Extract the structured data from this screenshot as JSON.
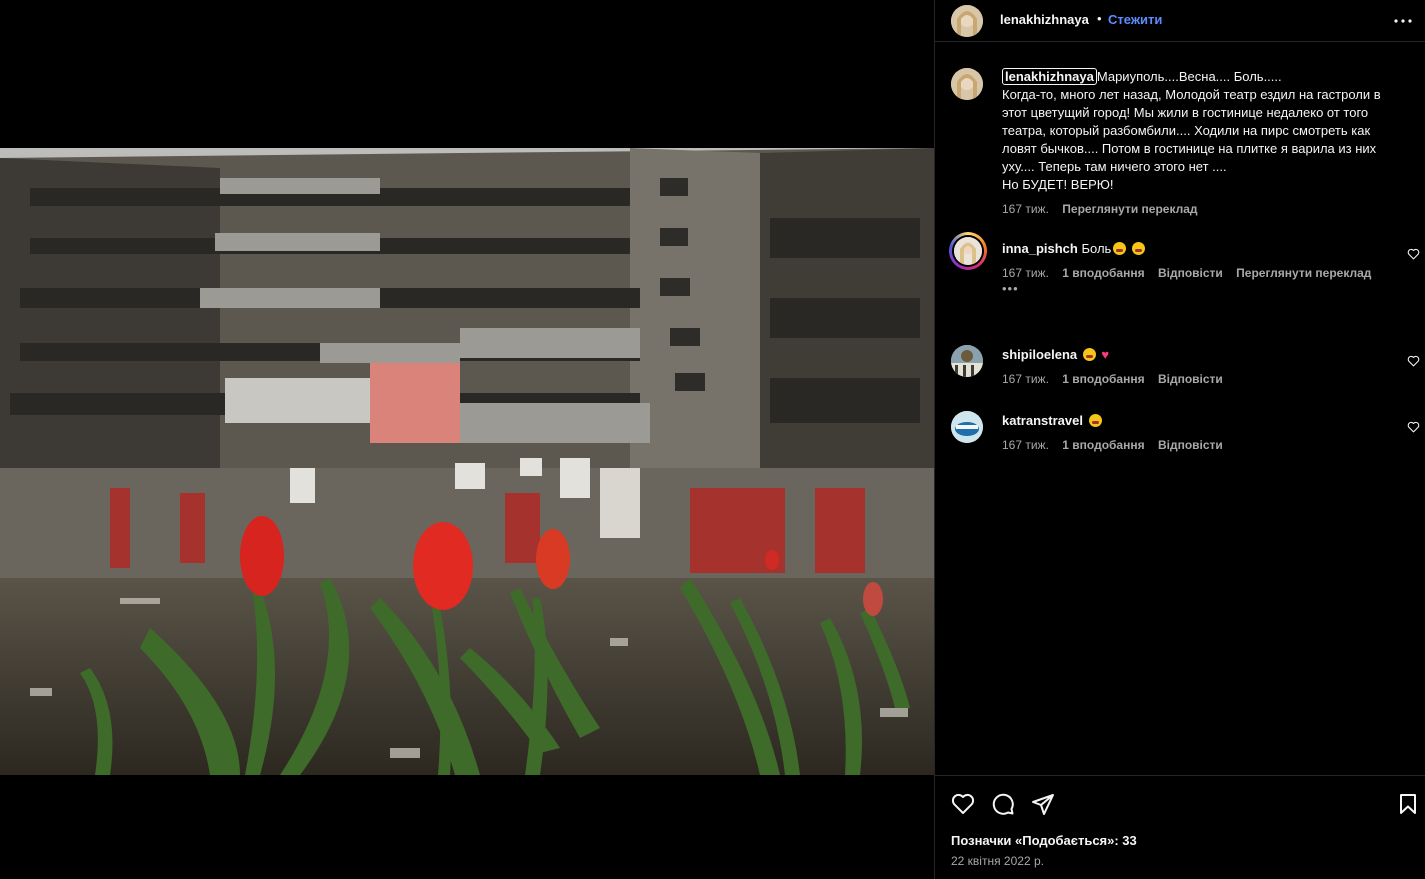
{
  "post": {
    "username": "lenakhizhnaya",
    "dot": "•",
    "follow_label": "Стежити"
  },
  "caption": {
    "username": "lenakhizhnaya",
    "text_line1": "Мариуполь....Весна.... Боль.....",
    "text_body": "Когда-то, много лет назад, Молодой театр ездил на гастроли в этот цветущий город! Мы жили в гостинице недалеко от того театра, который разбомбили.... Ходили на пирс смотреть как ловят бычков.... Потом в гостинице на плитке я варила из них уху.... Теперь там ничего этого нет ....",
    "text_last": "Но БУДЕТ! ВЕРЮ!",
    "time": "167 тиж.",
    "translate": "Переглянути переклад"
  },
  "comments": [
    {
      "username": "inna_pishch",
      "text": "Боль",
      "time": "167 тиж.",
      "likes": "1 вподобання",
      "reply": "Відповісти",
      "translate": "Переглянути переклад",
      "more": "•••"
    },
    {
      "username": "shipiloelena",
      "text": "",
      "time": "167 тиж.",
      "likes": "1 вподобання",
      "reply": "Відповісти"
    },
    {
      "username": "katranstravel",
      "text": "",
      "time": "167 тиж.",
      "likes": "1 вподобання",
      "reply": "Відповісти"
    }
  ],
  "footer": {
    "likes_label": "Позначки «Подобається»: 33",
    "date": "22 квітня 2022 р."
  },
  "colors": {
    "background": "#000000",
    "text": "#f5f5f5",
    "secondary": "#a8a8a8",
    "link": "#5b8dff",
    "divider": "#262626"
  },
  "icons": [
    "more-horizontal-icon",
    "heart-icon",
    "comment-icon",
    "share-icon",
    "bookmark-icon"
  ]
}
